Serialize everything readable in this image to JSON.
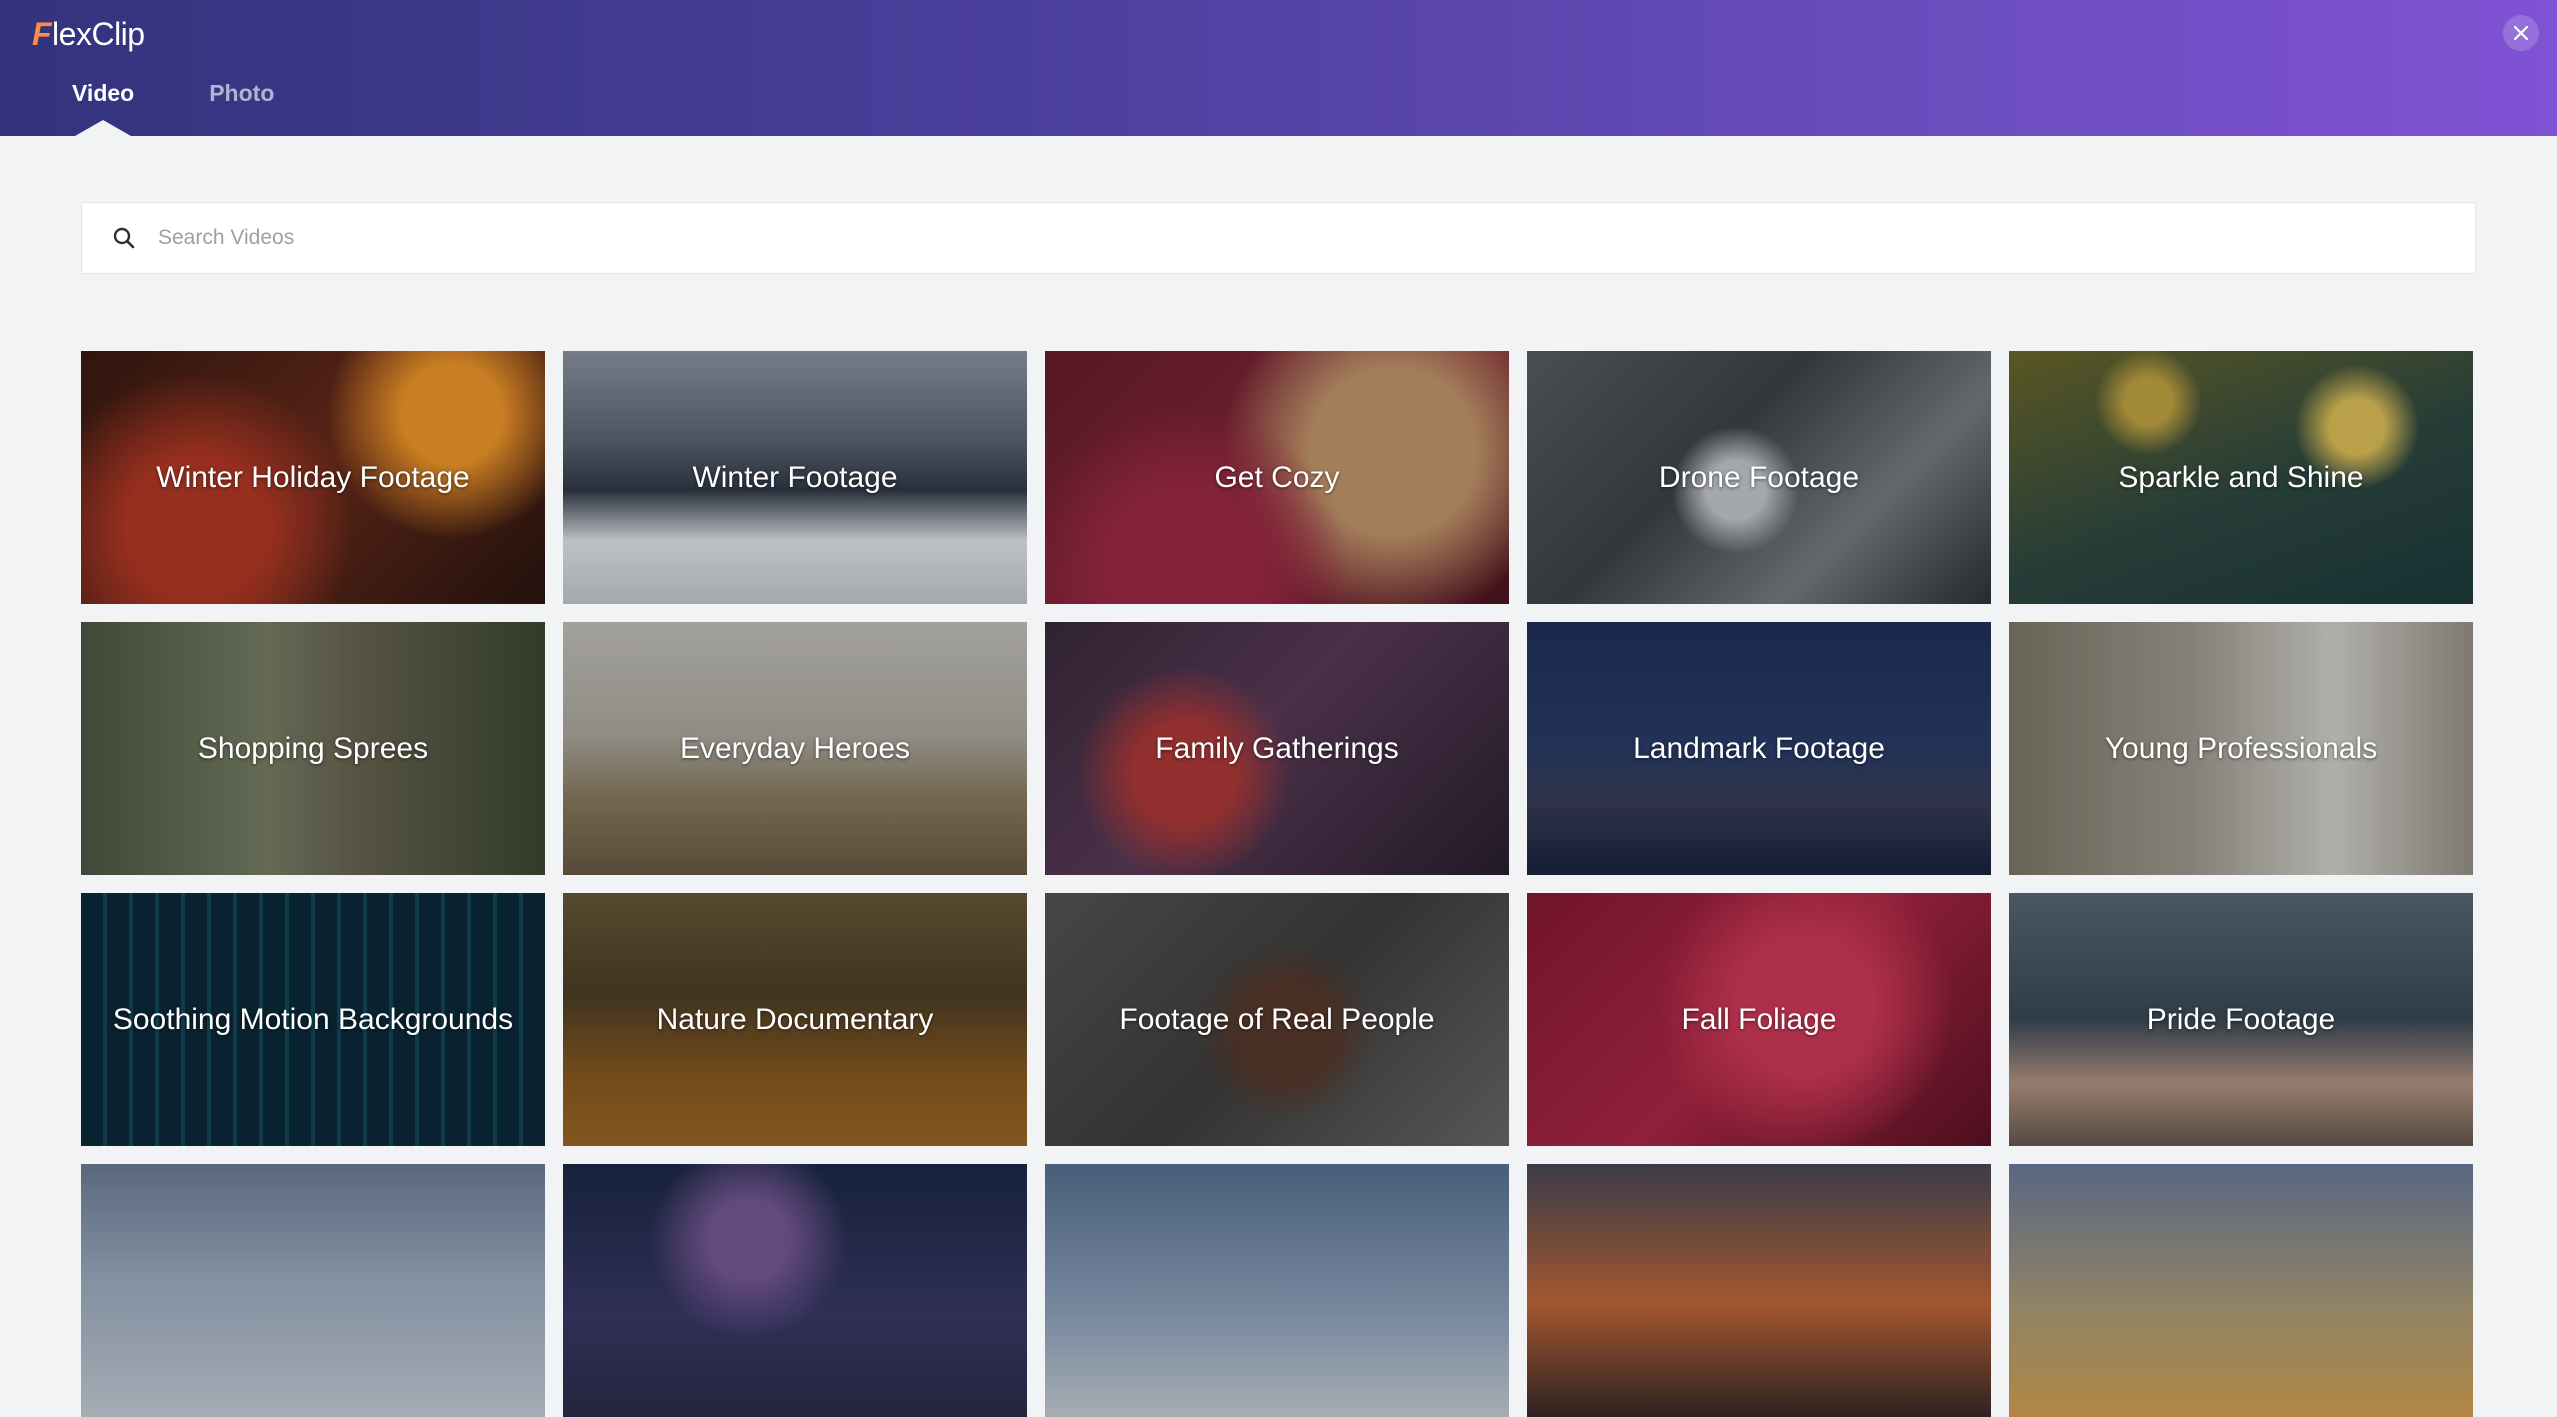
{
  "app": {
    "logo_mark": "F",
    "logo_text": "lexClip"
  },
  "tabs": [
    {
      "label": "Video",
      "active": true
    },
    {
      "label": "Photo",
      "active": false
    }
  ],
  "search": {
    "placeholder": "Search Videos",
    "value": ""
  },
  "tiles": [
    {
      "label": "Winter Holiday Footage"
    },
    {
      "label": "Winter Footage"
    },
    {
      "label": "Get Cozy"
    },
    {
      "label": "Drone Footage"
    },
    {
      "label": "Sparkle and Shine"
    },
    {
      "label": "Shopping Sprees"
    },
    {
      "label": "Everyday Heroes"
    },
    {
      "label": "Family Gatherings"
    },
    {
      "label": "Landmark Footage"
    },
    {
      "label": "Young Professionals"
    },
    {
      "label": "Soothing Motion Backgrounds"
    },
    {
      "label": "Nature Documentary"
    },
    {
      "label": "Footage of Real People"
    },
    {
      "label": "Fall Foliage"
    },
    {
      "label": "Pride Footage"
    }
  ],
  "colors": {
    "header_start": "#33337d",
    "header_end": "#8052d4",
    "logo_accent": "#ff8c42",
    "page_bg": "#f2f3f5"
  }
}
